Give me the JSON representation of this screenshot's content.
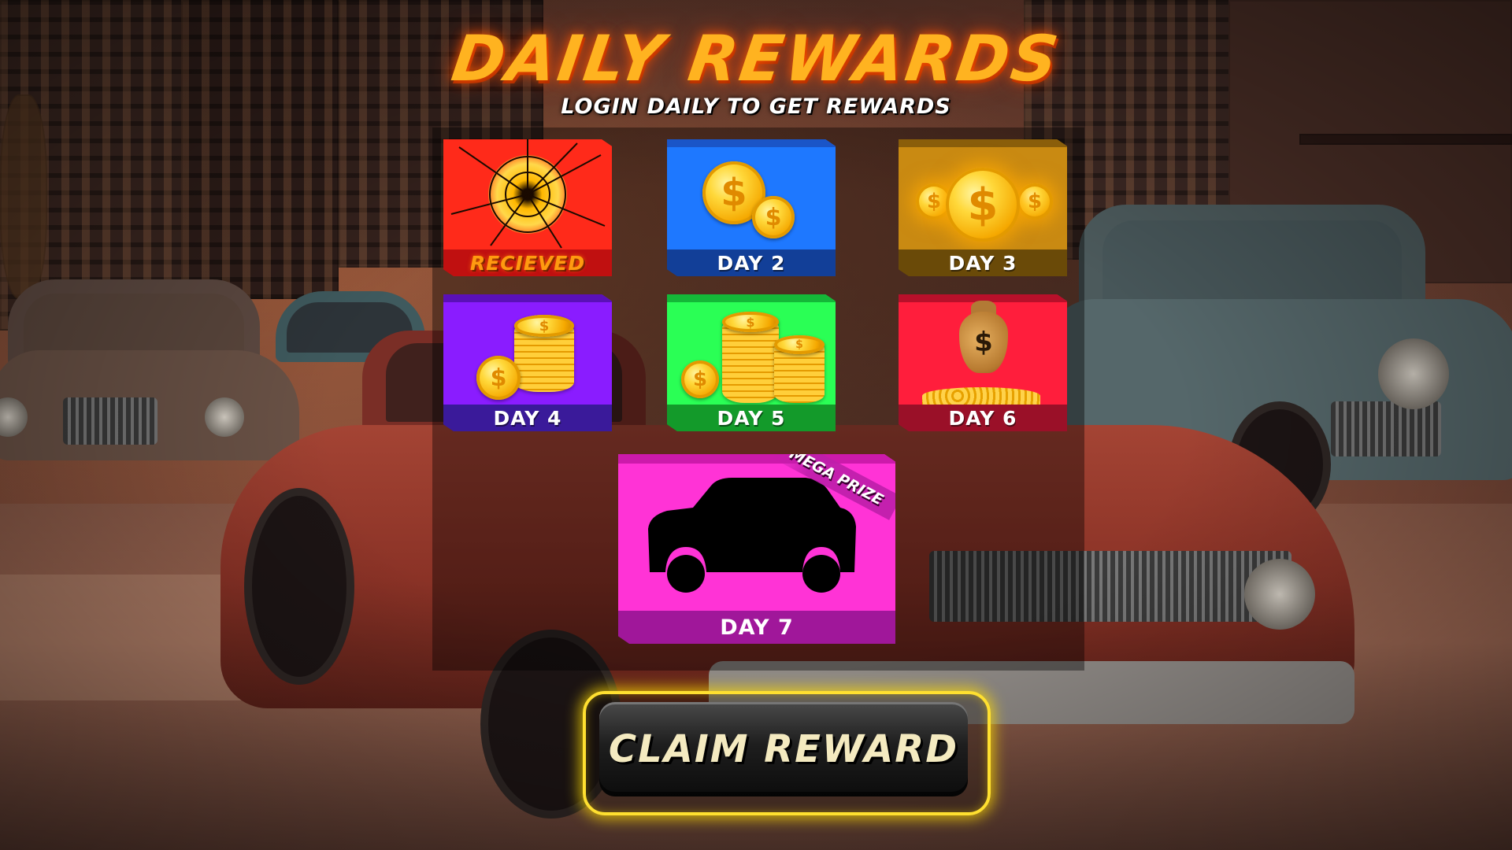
{
  "header": {
    "title": "DAILY REWARDS",
    "subtitle": "LOGIN DAILY TO GET REWARDS"
  },
  "rewards": [
    {
      "day_label": "RECIEVED",
      "status": "received",
      "color": "#ff2a1a",
      "band_color": "#c01010",
      "icon": "shattered-glass-coin-icon"
    },
    {
      "day_label": "DAY 2",
      "status": "locked",
      "color": "#1e78ff",
      "band_color": "#123f98",
      "icon": "coins-icon"
    },
    {
      "day_label": "DAY 3",
      "status": "locked",
      "color": "#c98a12",
      "band_color": "#6a4a08",
      "icon": "coins-icon"
    },
    {
      "day_label": "DAY 4",
      "status": "locked",
      "color": "#8a1cff",
      "band_color": "#3a1a9a",
      "icon": "coin-stack-icon"
    },
    {
      "day_label": "DAY 5",
      "status": "locked",
      "color": "#2aff55",
      "band_color": "#139a2a",
      "icon": "coin-stacks-icon"
    },
    {
      "day_label": "DAY 6",
      "status": "locked",
      "color": "#ff1e3c",
      "band_color": "#9a1028",
      "icon": "money-bag-icon"
    }
  ],
  "mega_reward": {
    "day_label": "DAY 7",
    "badge": "MEGA PRIZE",
    "color": "#ff33d6",
    "band_color": "#a0179a",
    "icon": "mystery-car-silhouette-icon"
  },
  "claim_button": {
    "label": "CLAIM REWARD",
    "accent": "#ffe030"
  }
}
